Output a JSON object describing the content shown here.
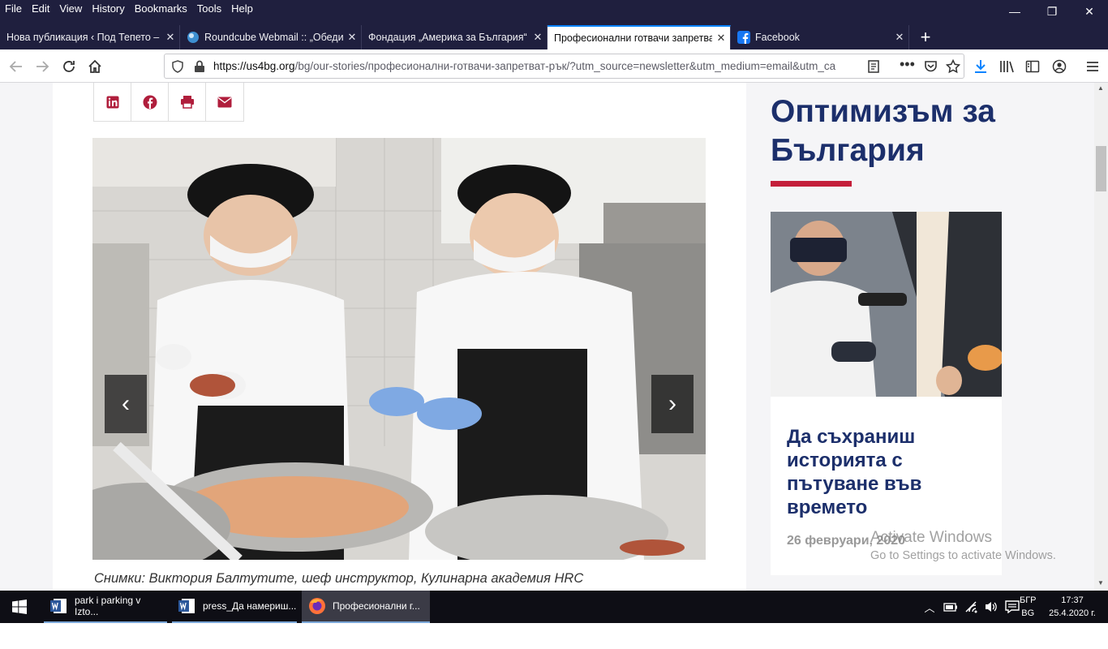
{
  "menu": [
    "File",
    "Edit",
    "View",
    "History",
    "Bookmarks",
    "Tools",
    "Help"
  ],
  "window_controls": {
    "minimize": "—",
    "restore": "❐",
    "close": "✕"
  },
  "tabs": [
    {
      "label": "Нова публикация ‹ Под Тепето – I",
      "favicon_color": "#1f1f3e",
      "active": false
    },
    {
      "label": "Roundcube Webmail :: „Обеди",
      "favicon_color": "#3d8fd1",
      "active": false
    },
    {
      "label": "Фондация „Америка за България“",
      "favicon_color": "#1f1f3e",
      "active": false
    },
    {
      "label": "Професионални готвачи запретват",
      "favicon_color": "#ffffff",
      "active": true
    },
    {
      "label": "Facebook",
      "favicon_color": "#1877f2",
      "active": false
    }
  ],
  "new_tab_label": "+",
  "url": {
    "domain": "https://us4bg.org",
    "path": "/bg/our-stories/професионални-готвачи-запретват-рък/?utm_source=newsletter&utm_medium=email&utm_ca"
  },
  "article": {
    "caption": "Снимки: Виктория Балтутите, шеф инструктор, Кулинарна академия HRC",
    "photo_alt": "Two chefs preparing food in a kitchen",
    "prev_arrow": "‹",
    "next_arrow": "›",
    "brand_color": "#b01e3c"
  },
  "sidebar": {
    "title": "Оптимизъм за България",
    "card_title": "Да съхраниш историята с пътуване във времето",
    "card_date": "26 февруари, 2020"
  },
  "watermark": {
    "line1": "Activate Windows",
    "line2": "Go to Settings to activate Windows."
  },
  "taskbar": {
    "items": [
      {
        "label": "park i parking v Izto...",
        "icon_color": "#2b579a",
        "active": false
      },
      {
        "label": "press_Да намериш...",
        "icon_color": "#2b579a",
        "active": false
      },
      {
        "label": "Професионални г...",
        "icon_color": "#ff7139",
        "active": true
      }
    ],
    "lang_line1": "БГР",
    "lang_line2": "BG",
    "time": "17:37",
    "date": "25.4.2020 г."
  }
}
